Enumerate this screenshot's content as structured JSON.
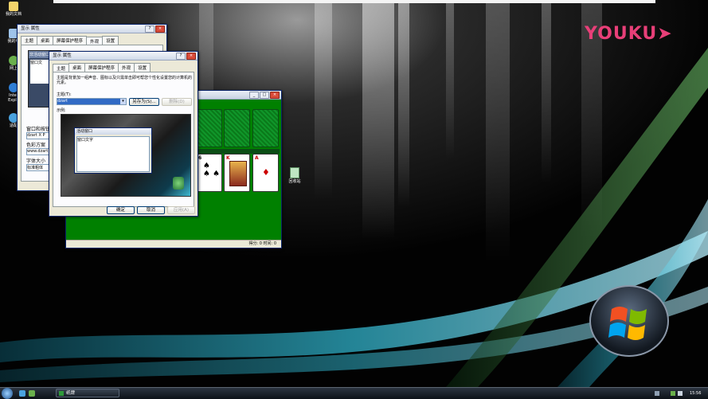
{
  "desktop": {
    "watermark": "YOUKU",
    "icons": [
      "我的文档",
      "我的电",
      "网上",
      "Inter Explo",
      "适配"
    ]
  },
  "back_window": {
    "title": "显示 属性",
    "tabs": [
      "主题",
      "桌面",
      "屏幕保护程序",
      "外观",
      "设置"
    ],
    "active_tab": "外观",
    "labels": [
      "窗口和按钮",
      "色彩方案",
      "字体大小"
    ],
    "fields": [
      "dzart X P",
      "www.dzart",
      "标准粗体"
    ],
    "preview_title": "非活动窗口",
    "preview_text": "窗口文"
  },
  "front_window": {
    "title": "显示 属性",
    "tabs": [
      "主题",
      "桌面",
      "屏幕保护程序",
      "外观",
      "设置"
    ],
    "active_tab": "主题",
    "description": "主题是背景加一组声音、图标以及只需单击即可帮您个性化设置您的计算机的元素。",
    "theme_label": "主题(T):",
    "theme_value": "dzart",
    "save_as": "另存为(S)...",
    "delete": "删除(D)",
    "sample_label": "示例:",
    "sample_window_title": "活动窗口",
    "sample_window_text": "窗口文字",
    "ok": "确定",
    "cancel": "取消",
    "apply": "应用(A)"
  },
  "solitaire": {
    "status": "得分: 0 时间: 0"
  },
  "recycle_bin": {
    "label": "回收站"
  },
  "taskbar": {
    "item": "纸牌",
    "clock": "15:56"
  }
}
